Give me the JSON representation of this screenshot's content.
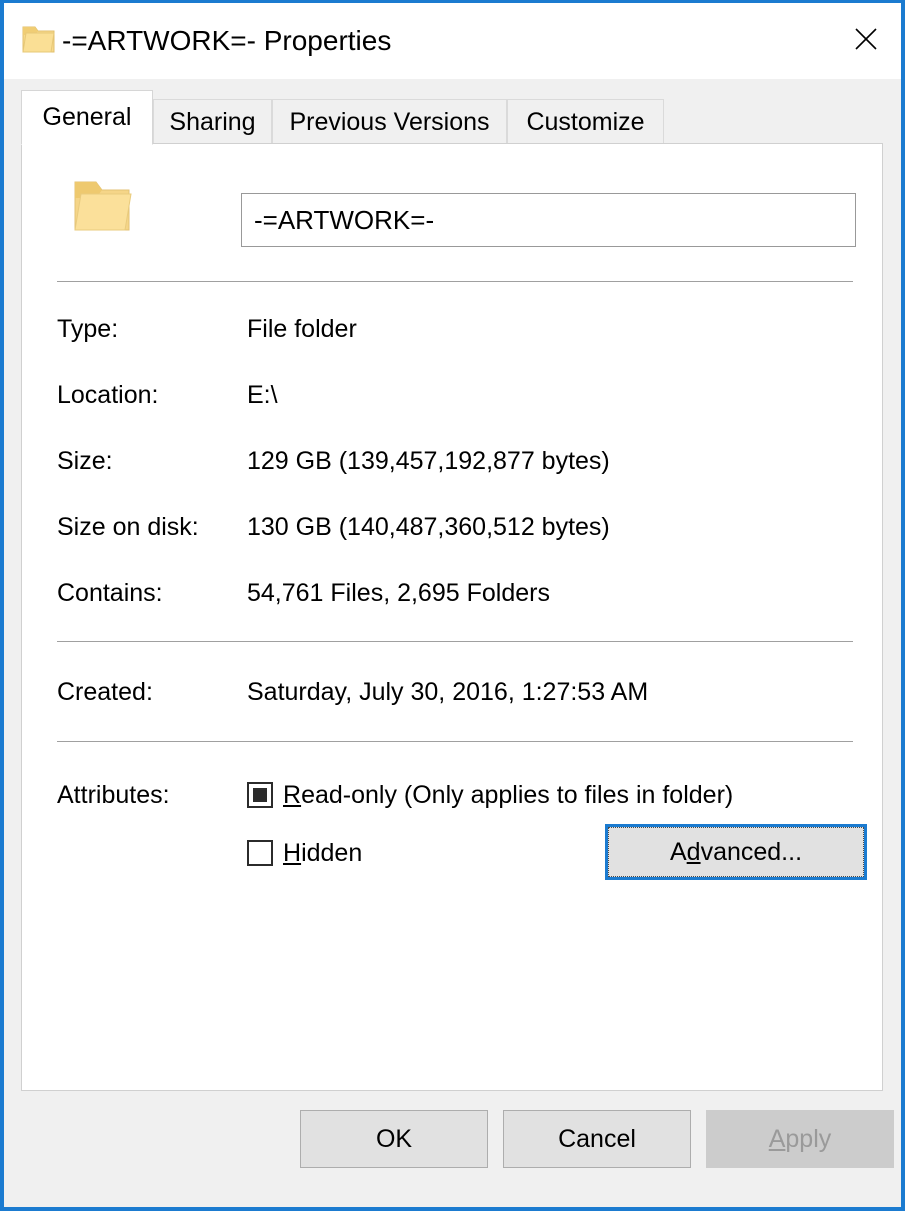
{
  "window": {
    "title": "-=ARTWORK=- Properties",
    "icon": "folder-icon",
    "close_label": "✕",
    "accent_color": "#1b7bd0"
  },
  "tabs": [
    {
      "label": "General",
      "active": true
    },
    {
      "label": "Sharing",
      "active": false
    },
    {
      "label": "Previous Versions",
      "active": false
    },
    {
      "label": "Customize",
      "active": false
    }
  ],
  "general": {
    "folder_icon": "folder-icon",
    "name_value": "-=ARTWORK=-",
    "rows": [
      {
        "label": "Type:",
        "value": "File folder"
      },
      {
        "label": "Location:",
        "value": "E:\\"
      },
      {
        "label": "Size:",
        "value": "129 GB (139,457,192,877 bytes)"
      },
      {
        "label": "Size on disk:",
        "value": "130 GB (140,487,360,512 bytes)"
      },
      {
        "label": "Contains:",
        "value": "54,761 Files, 2,695 Folders"
      },
      {
        "label": "Created:",
        "value": "Saturday, July 30, 2016, 1:27:53 AM"
      }
    ],
    "attributes": {
      "label": "Attributes:",
      "readonly": {
        "mnemonic": "R",
        "rest": "ead-only (Only applies to files in folder)",
        "state": "indeterminate"
      },
      "hidden": {
        "mnemonic": "H",
        "rest": "idden",
        "state": "unchecked"
      },
      "advanced_pre": "A",
      "advanced_mnemonic": "d",
      "advanced_post": "vanced..."
    }
  },
  "footer": {
    "ok": "OK",
    "cancel": "Cancel",
    "apply_mnemonic": "A",
    "apply_rest": "pply",
    "apply_enabled": false
  }
}
